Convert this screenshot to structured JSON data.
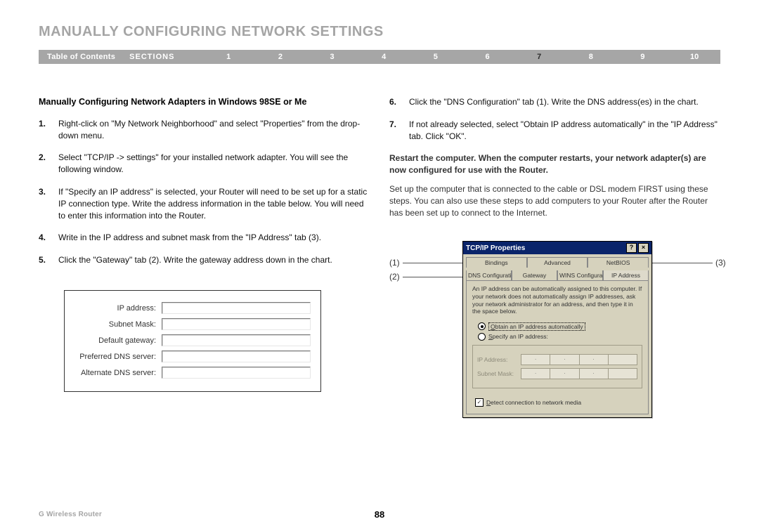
{
  "section_title": "MANUALLY CONFIGURING NETWORK SETTINGS",
  "nav": {
    "toc": "Table of Contents",
    "sections_label": "SECTIONS",
    "numbers": [
      "1",
      "2",
      "3",
      "4",
      "5",
      "6",
      "7",
      "8",
      "9",
      "10"
    ],
    "active": "7"
  },
  "subhead": "Manually Configuring Network Adapters in Windows 98SE or Me",
  "steps_left": [
    {
      "n": "1.",
      "t": "Right-click on \"My Network Neighborhood\" and select \"Properties\" from the drop-down menu."
    },
    {
      "n": "2.",
      "t": "Select \"TCP/IP -> settings\" for your installed network adapter. You will see the following window."
    },
    {
      "n": "3.",
      "t": "If \"Specify an IP address\" is selected, your Router will need to be set up for a static IP connection type. Write the address information in the table below. You will need to enter this information into the Router."
    },
    {
      "n": "4.",
      "t": "Write in the IP address and subnet mask from the \"IP Address\" tab (3)."
    },
    {
      "n": "5.",
      "t": "Click the \"Gateway\" tab (2). Write the gateway address down in the chart."
    }
  ],
  "steps_right": [
    {
      "n": "6.",
      "t": "Click the \"DNS Configuration\" tab (1). Write the DNS address(es) in the chart."
    },
    {
      "n": "7.",
      "t": "If not already selected, select \"Obtain IP address automatically\" in the \"IP Address\" tab. Click \"OK\"."
    }
  ],
  "restart_note": "Restart the computer. When the computer restarts, your network adapter(s) are now configured for use with the Router.",
  "follow_note": "Set up the computer that is connected to the cable or DSL modem FIRST using these steps. You can also use these steps to add computers to your Router after the Router has been set up to connect to the Internet.",
  "ip_chart_labels": [
    "IP address:",
    "Subnet Mask:",
    "Default gateway:",
    "Preferred DNS server:",
    "Alternate DNS server:"
  ],
  "callouts": {
    "c1": "(1)",
    "c2": "(2)",
    "c3": "(3)"
  },
  "tcpip": {
    "title": "TCP/IP Properties",
    "help_btn": "?",
    "close_btn": "×",
    "tabs_row1": [
      "Bindings",
      "Advanced",
      "NetBIOS"
    ],
    "tabs_row2": [
      "DNS Configuration",
      "Gateway",
      "WINS Configuration",
      "IP Address"
    ],
    "active_tab": "IP Address",
    "desc": "An IP address can be automatically assigned to this computer. If your network does not automatically assign IP addresses, ask your network administrator for an address, and then type it in the space below.",
    "opt_auto": "Obtain an IP address automatically",
    "opt_specify": "Specify an IP address:",
    "ip_label": "IP Address:",
    "subnet_label": "Subnet Mask:",
    "detect": "Detect connection to network media"
  },
  "footer": {
    "product": "G Wireless Router",
    "page": "88"
  }
}
